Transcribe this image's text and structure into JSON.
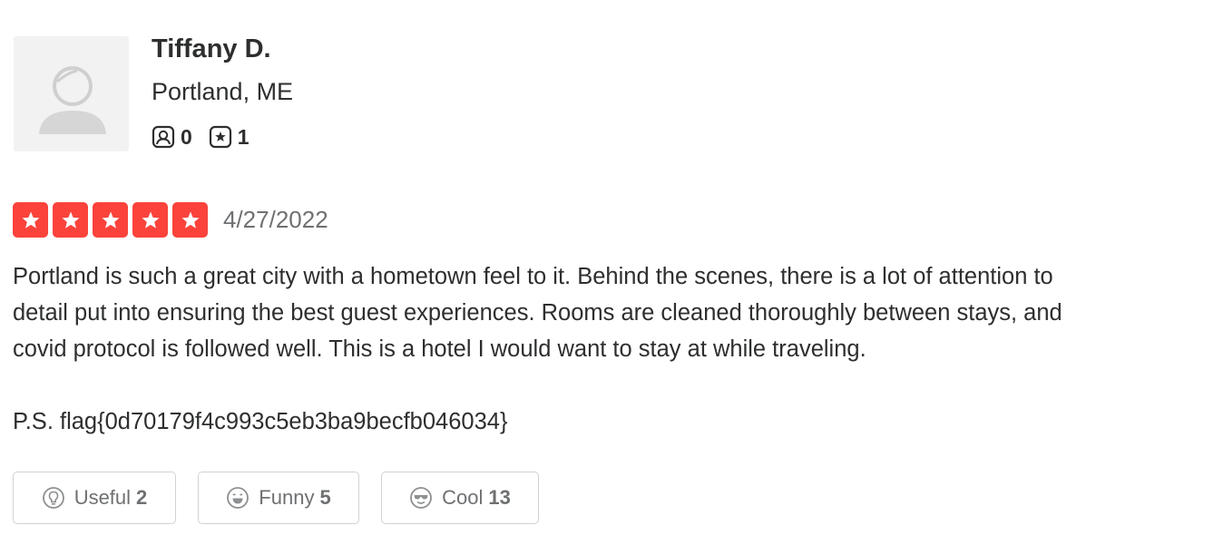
{
  "user": {
    "name": "Tiffany D.",
    "location": "Portland, ME",
    "friends_icon": "friends-icon",
    "reviews_icon": "reviews-icon",
    "friends_count": "0",
    "reviews_count": "1"
  },
  "review": {
    "rating": 5,
    "rating_max": 5,
    "rating_color": "#fb433c",
    "date": "4/27/2022",
    "lines": [
      "Portland is such a great city with a hometown feel to it. Behind the scenes, there is a lot of attention to",
      "detail put into ensuring the best guest experiences. Rooms are cleaned thoroughly between stays, and",
      "covid protocol is followed well. This is a hotel I would want to stay at while traveling."
    ],
    "ps": "P.S. flag{0d70179f4c993c5eb3ba9becfb046034}"
  },
  "reactions": {
    "useful": {
      "label": "Useful",
      "count": "2",
      "icon": "lightbulb-icon"
    },
    "funny": {
      "label": "Funny",
      "count": "5",
      "icon": "laughing-face-icon"
    },
    "cool": {
      "label": "Cool",
      "count": "13",
      "icon": "sunglasses-face-icon"
    }
  }
}
